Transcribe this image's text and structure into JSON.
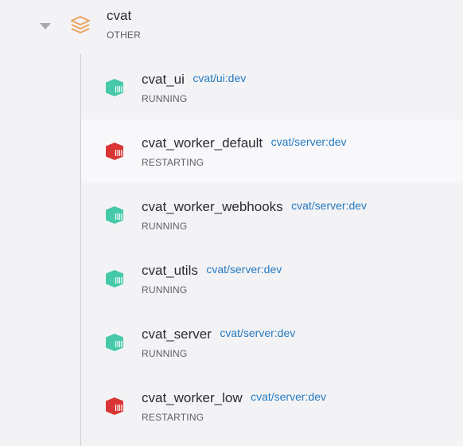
{
  "group": {
    "name": "cvat",
    "type": "OTHER",
    "expanded": true,
    "icon": "layers-stack-icon",
    "icon_color": "#e8a15e",
    "caret_icon": "caret-down-icon"
  },
  "colors": {
    "running": "#46c9a9",
    "restarting": "#d93535",
    "image_link": "#2479c1",
    "hover_row": "#f8f8fa"
  },
  "containers": [
    {
      "name": "cvat_ui",
      "image": "cvat/ui:dev",
      "status": "RUNNING",
      "icon": "container-icon"
    },
    {
      "name": "cvat_worker_default",
      "image": "cvat/server:dev",
      "status": "RESTARTING",
      "icon": "container-icon"
    },
    {
      "name": "cvat_worker_webhooks",
      "image": "cvat/server:dev",
      "status": "RUNNING",
      "icon": "container-icon"
    },
    {
      "name": "cvat_utils",
      "image": "cvat/server:dev",
      "status": "RUNNING",
      "icon": "container-icon"
    },
    {
      "name": "cvat_server",
      "image": "cvat/server:dev",
      "status": "RUNNING",
      "icon": "container-icon"
    },
    {
      "name": "cvat_worker_low",
      "image": "cvat/server:dev",
      "status": "RESTARTING",
      "icon": "container-icon"
    }
  ]
}
